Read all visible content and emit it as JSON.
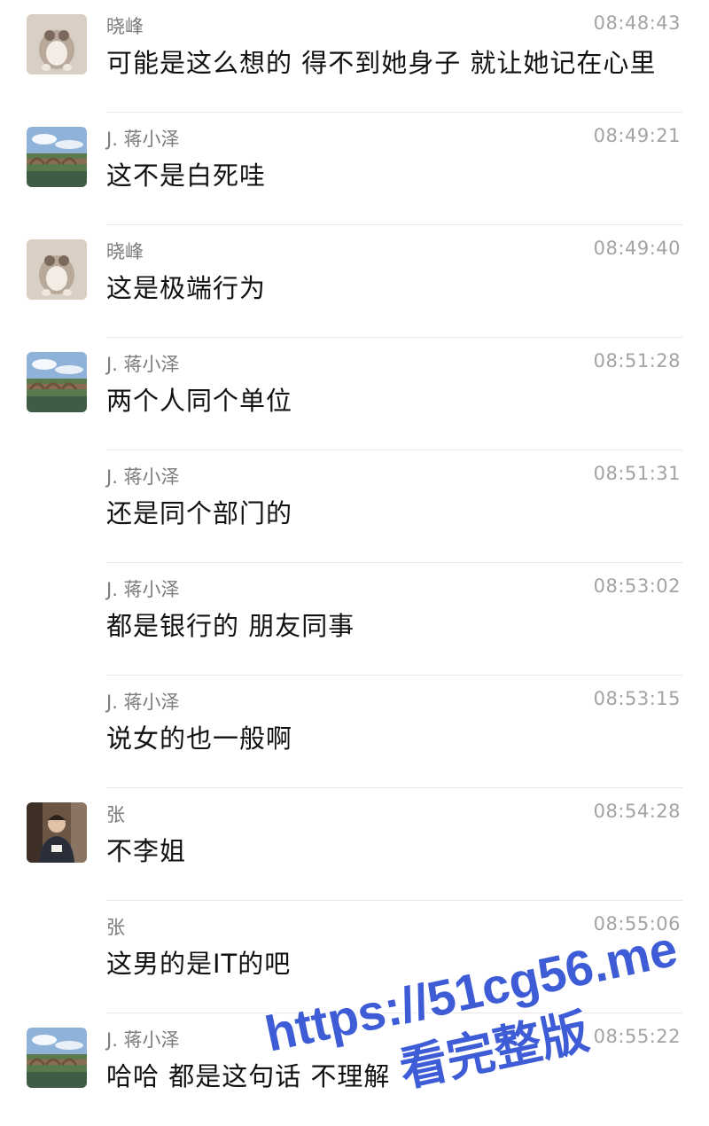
{
  "messages": [
    {
      "sender": "晓峰",
      "time": "08:48:43",
      "text": "可能是这么想的  得不到她身子  就让她记在心里",
      "avatar": "cat"
    },
    {
      "sender": "J. 蒋小泽",
      "time": "08:49:21",
      "text": "这不是白死哇",
      "avatar": "bridge"
    },
    {
      "sender": "晓峰",
      "time": "08:49:40",
      "text": "这是极端行为",
      "avatar": "cat"
    },
    {
      "sender": "J. 蒋小泽",
      "time": "08:51:28",
      "text": "两个人同个单位",
      "avatar": "bridge"
    },
    {
      "sender": "J. 蒋小泽",
      "time": "08:51:31",
      "text": "还是同个部门的",
      "avatar": ""
    },
    {
      "sender": "J. 蒋小泽",
      "time": "08:53:02",
      "text": "都是银行的 朋友同事",
      "avatar": ""
    },
    {
      "sender": "J. 蒋小泽",
      "time": "08:53:15",
      "text": "说女的也一般啊",
      "avatar": ""
    },
    {
      "sender": "张",
      "time": "08:54:28",
      "text": "不李姐",
      "avatar": "person"
    },
    {
      "sender": "张",
      "time": "08:55:06",
      "text": "这男的是IT的吧",
      "avatar": ""
    },
    {
      "sender": "J. 蒋小泽",
      "time": "08:55:22",
      "text": "哈哈 都是这句话 不理解",
      "avatar": "bridge"
    }
  ],
  "watermark": {
    "line1": "https://51cg56.me",
    "line2": "看完整版",
    "color": "#3d5cd6"
  }
}
